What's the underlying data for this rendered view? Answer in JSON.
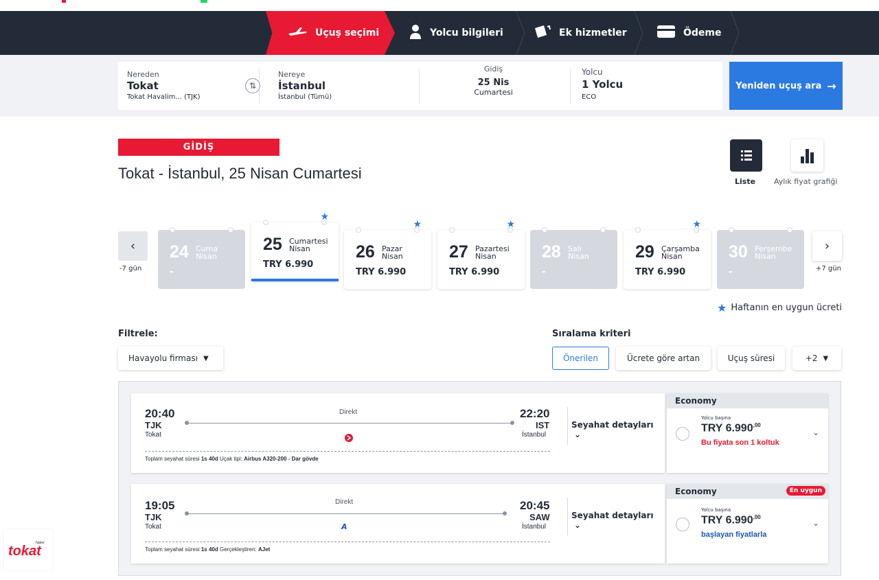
{
  "steps": [
    {
      "label": "Uçuş seçimi",
      "active": true
    },
    {
      "label": "Yolcu bilgileri",
      "active": false
    },
    {
      "label": "Ek hizmetler",
      "active": false
    },
    {
      "label": "Ödeme",
      "active": false
    }
  ],
  "search": {
    "from": {
      "label": "Nereden",
      "city": "Tokat",
      "airport": "Tokat Havalim... (TJK)"
    },
    "to": {
      "label": "Nereye",
      "city": "İstanbul",
      "airport": "İstanbul (Tümü)"
    },
    "departure": {
      "label": "Gidiş",
      "date": "25 Nis",
      "day": "Cumartesi"
    },
    "passenger": {
      "label": "Yolcu",
      "count": "1 Yolcu",
      "cabin": "ECO"
    },
    "research_button": "Yeniden uçuş ara"
  },
  "header": {
    "tag": "GİDİŞ",
    "title": "Tokat - İstanbul, 25 Nisan Cumartesi"
  },
  "views": {
    "list": "Liste",
    "chart": "Aylık fiyat grafiği"
  },
  "datestrip": {
    "prev_label": "-7 gün",
    "next_label": "+7 gün",
    "days": [
      {
        "num": "24",
        "weekday": "Cuma",
        "month": "Nisan",
        "price": "-",
        "available": false,
        "best": false,
        "selected": false
      },
      {
        "num": "25",
        "weekday": "Cumartesi",
        "month": "Nisan",
        "price": "TRY 6.990",
        "available": true,
        "best": true,
        "selected": true
      },
      {
        "num": "26",
        "weekday": "Pazar",
        "month": "Nisan",
        "price": "TRY 6.990",
        "available": true,
        "best": true,
        "selected": false
      },
      {
        "num": "27",
        "weekday": "Pazartesi",
        "month": "Nisan",
        "price": "TRY 6.990",
        "available": true,
        "best": true,
        "selected": false
      },
      {
        "num": "28",
        "weekday": "Salı",
        "month": "Nisan",
        "price": "-",
        "available": false,
        "best": false,
        "selected": false
      },
      {
        "num": "29",
        "weekday": "Çarşamba",
        "month": "Nisan",
        "price": "TRY 6.990",
        "available": true,
        "best": true,
        "selected": false
      },
      {
        "num": "30",
        "weekday": "Perşembe",
        "month": "Nisan",
        "price": "-",
        "available": false,
        "best": false,
        "selected": false
      }
    ],
    "best_week_note": "Haftanın en uygun ücreti"
  },
  "filters": {
    "label": "Filtrele:",
    "airline_dropdown": "Havayolu firması",
    "sort_label": "Sıralama kriteri",
    "sort_options": [
      "Önerilen",
      "Ücrete göre artan",
      "Uçuş süresi",
      "+2"
    ]
  },
  "flights": [
    {
      "dep_time": "20:40",
      "dep_code": "TJK",
      "dep_city": "Tokat",
      "arr_time": "22:20",
      "arr_code": "IST",
      "arr_city": "İstanbul",
      "type": "Direkt",
      "info_label1": "Toplam seyahat süresi",
      "duration": "1s 40d",
      "info_label2": "Uçak tipi:",
      "info_value2": "Airbus A320-200 - Dar gövde",
      "details": "Seyahat detayları",
      "fare_class": "Economy",
      "badge": "",
      "per_pax": "Yolcu başına",
      "price": "TRY 6.990",
      "price_cents": ",00",
      "note": "Bu fiyata son 1 koltuk",
      "note_color": "red"
    },
    {
      "dep_time": "19:05",
      "dep_code": "TJK",
      "dep_city": "Tokat",
      "arr_time": "20:45",
      "arr_code": "SAW",
      "arr_city": "İstanbul",
      "type": "Direkt",
      "info_label1": "Toplam seyahat süresi",
      "duration": "1s 40d",
      "info_label2": "Gerçekleştiren:",
      "info_value2": "AJet",
      "details": "Seyahat detayları",
      "fare_class": "Economy",
      "badge": "En uygun",
      "per_pax": "Yolcu başına",
      "price": "TRY 6.990",
      "price_cents": ",00",
      "note": "başlayan fiyatlarla",
      "note_color": "blue"
    }
  ],
  "watermark": {
    "brand": "tokat",
    "sub": "haber"
  },
  "colors": {
    "red": "#e81932",
    "navy": "#232b38",
    "blue": "#2a7ae2"
  }
}
